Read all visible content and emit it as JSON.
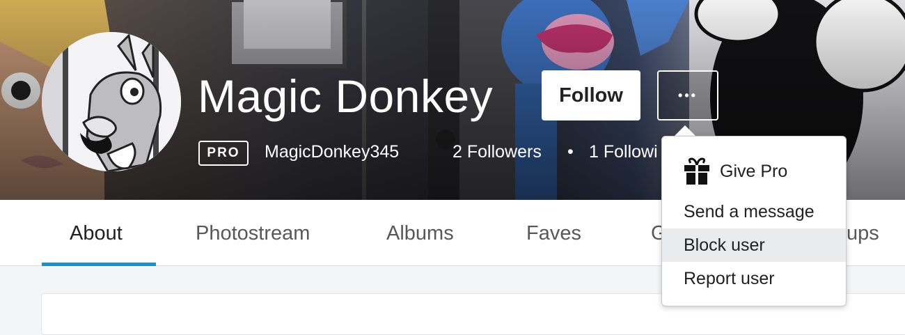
{
  "profile": {
    "display_name": "Magic Donkey",
    "badge": "PRO",
    "handle": "MagicDonkey345",
    "followers": "2 Followers",
    "separator": "•",
    "following": "1 Followi"
  },
  "actions": {
    "follow_label": "Follow",
    "more_label": "•••"
  },
  "tabs": [
    {
      "label": "About",
      "active": true
    },
    {
      "label": "Photostream"
    },
    {
      "label": "Albums"
    },
    {
      "label": "Faves"
    },
    {
      "label": "G"
    },
    {
      "label": "ups"
    }
  ],
  "menu": {
    "items": [
      {
        "label": "Give Pro",
        "icon": "gift-icon"
      },
      {
        "label": "Send a message"
      },
      {
        "label": "Block user",
        "highlighted": true
      },
      {
        "label": "Report user"
      }
    ]
  },
  "colors": {
    "accent": "#1b8fd6",
    "hover_bg": "#e9ecee"
  }
}
